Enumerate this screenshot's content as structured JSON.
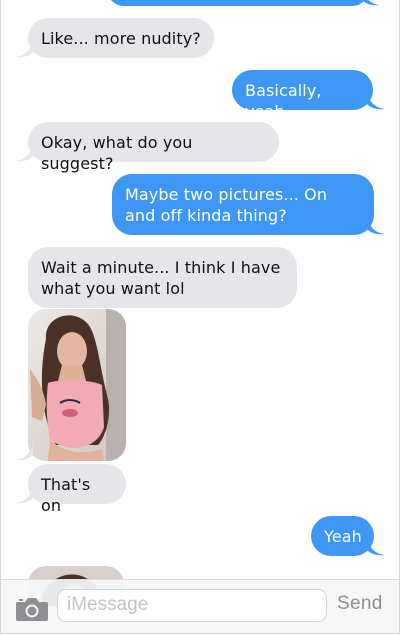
{
  "conversation": {
    "messages": [
      {
        "from": "them",
        "text": "Like... more nudity?"
      },
      {
        "from": "me",
        "text": "Basically, yeah"
      },
      {
        "from": "them",
        "text": "Okay, what do you suggest?"
      },
      {
        "from": "me",
        "text": "Maybe two pictures... On and off kinda thing?"
      },
      {
        "from": "them",
        "text": "Wait a minute... I think I have what you want lol"
      },
      {
        "from": "them",
        "text": "That's on"
      },
      {
        "from": "me",
        "text": "Yeah"
      }
    ]
  },
  "input_bar": {
    "placeholder": "iMessage",
    "send_label": "Send"
  },
  "colors": {
    "incoming_bubble": "#e5e5ea",
    "outgoing_bubble": "#3f97f5",
    "send_disabled": "#8e8e93"
  }
}
